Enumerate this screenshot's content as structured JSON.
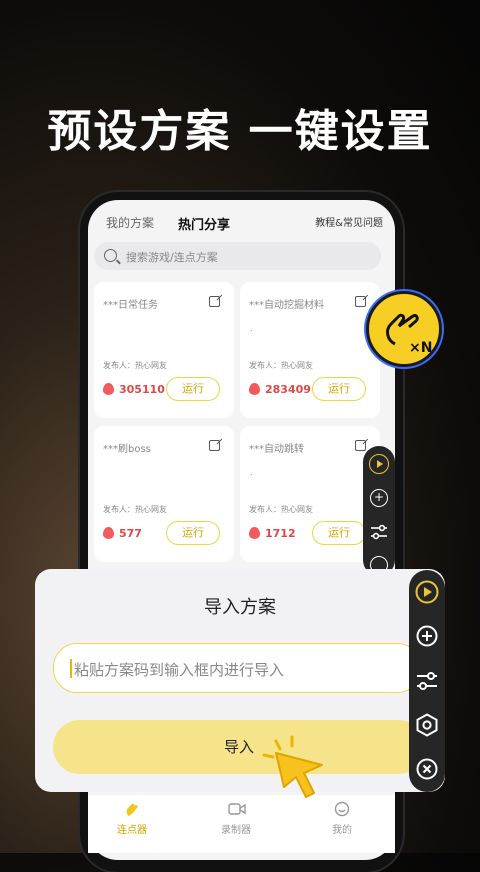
{
  "headline": "预设方案 一键设置",
  "tabs": [
    {
      "label": "我的方案"
    },
    {
      "label": "热门分享"
    }
  ],
  "help_link": "教程&常见问题",
  "search": {
    "placeholder": "搜索游戏/连点方案"
  },
  "cards": [
    {
      "title": "***日常任务",
      "publisher": "发布人：热心网友",
      "count": "305110",
      "run": "运行",
      "dot": ""
    },
    {
      "title": "***自动挖掘材料",
      "publisher": "发布人：热心网友",
      "count": "283409",
      "run": "运行",
      "dot": "."
    },
    {
      "title": "***刷boss",
      "publisher": "发布人：热心网友",
      "count": "577",
      "run": "运行",
      "dot": ""
    },
    {
      "title": "***自动跳转",
      "publisher": "发布人：热心网友",
      "count": "1712",
      "run": "运行",
      "dot": "."
    }
  ],
  "dialog": {
    "title": "导入方案",
    "input_placeholder": "粘贴方案码到输入框内进行导入",
    "import_label": "导入"
  },
  "bottom_nav": [
    {
      "label": "连点器"
    },
    {
      "label": "录制器"
    },
    {
      "label": "我的"
    }
  ],
  "colors": {
    "accent_yellow": "#f5e48a",
    "run_border": "#f0d24a",
    "count_red": "#e04848"
  },
  "icons": [
    "search-icon",
    "edit-icon",
    "flame-icon",
    "play-icon",
    "add-icon",
    "sliders-icon",
    "target-icon",
    "close-icon",
    "hand-icon",
    "video-icon",
    "smile-icon",
    "cursor-icon",
    "badge-icon"
  ]
}
